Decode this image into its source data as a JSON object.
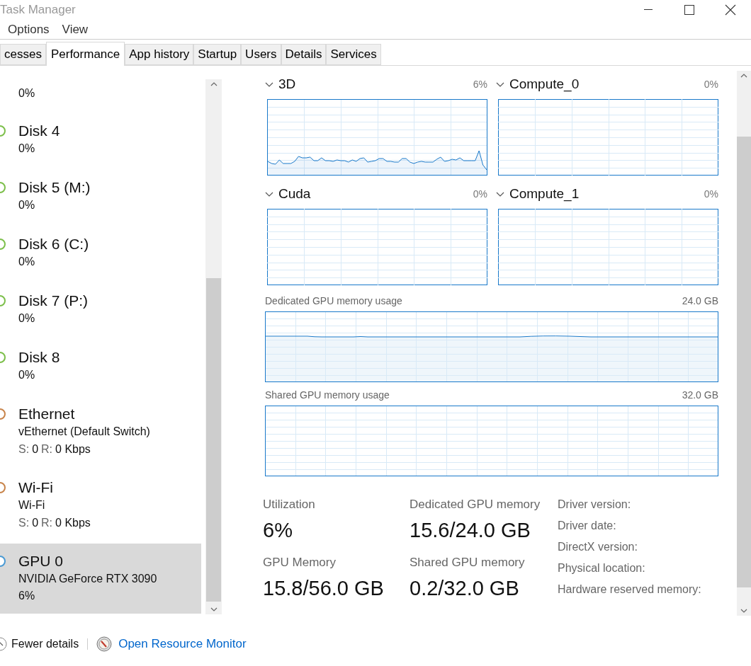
{
  "window": {
    "title": "Task Manager"
  },
  "menu": [
    "Options",
    "View"
  ],
  "tabs": [
    {
      "label": "cesses",
      "selected": false
    },
    {
      "label": "Performance",
      "selected": true
    },
    {
      "label": "App history",
      "selected": false
    },
    {
      "label": "Startup",
      "selected": false
    },
    {
      "label": "Users",
      "selected": false
    },
    {
      "label": "Details",
      "selected": false
    },
    {
      "label": "Services",
      "selected": false
    }
  ],
  "sidebar": {
    "items": [
      {
        "kind": "disk",
        "usage": "0%",
        "selected": false
      },
      {
        "kind": "disk",
        "title": "Disk 4",
        "usage": "0%",
        "selected": false,
        "color": "#7cbf4a"
      },
      {
        "kind": "disk",
        "title": "Disk 5 (M:)",
        "usage": "0%",
        "selected": false,
        "color": "#7cbf4a"
      },
      {
        "kind": "disk",
        "title": "Disk 6 (C:)",
        "usage": "0%",
        "selected": false,
        "color": "#7cbf4a"
      },
      {
        "kind": "disk",
        "title": "Disk 7 (P:)",
        "usage": "0%",
        "selected": false,
        "color": "#7cbf4a"
      },
      {
        "kind": "disk",
        "title": "Disk 8",
        "usage": "0%",
        "selected": false,
        "color": "#7cbf4a"
      },
      {
        "kind": "network",
        "title": "Ethernet",
        "adapter": "vEthernet (Default Switch)",
        "rates": [
          {
            "label": "S:",
            "value": "0"
          },
          {
            "label": "R:",
            "value": "0 Kbps"
          }
        ],
        "selected": false,
        "color": "#c8844a"
      },
      {
        "kind": "network",
        "title": "Wi-Fi",
        "adapter": "Wi-Fi",
        "rates": [
          {
            "label": "S:",
            "value": "0"
          },
          {
            "label": "R:",
            "value": "0 Kbps"
          }
        ],
        "selected": false,
        "color": "#c8844a"
      },
      {
        "kind": "gpu",
        "title": "GPU 0",
        "adapter": "NVIDIA GeForce RTX 3090",
        "usage": "6%",
        "selected": true,
        "color": "#4a9ad4"
      }
    ]
  },
  "engines": [
    {
      "name": "3D",
      "reading": "6%",
      "kind": "active"
    },
    {
      "name": "Compute_0",
      "reading": "0%",
      "kind": "idle"
    },
    {
      "name": "Cuda",
      "reading": "0%",
      "kind": "idle"
    },
    {
      "name": "Compute_1",
      "reading": "0%",
      "kind": "idle"
    }
  ],
  "memory_graphs": [
    {
      "title": "Dedicated GPU memory usage",
      "capacity": "24.0 GB",
      "kind": "filled"
    },
    {
      "title": "Shared GPU memory usage",
      "capacity": "32.0 GB",
      "kind": "empty"
    }
  ],
  "stats": [
    [
      {
        "label": "Utilization",
        "value": "6%"
      },
      {
        "label": "GPU Memory",
        "value": "15.8/56.0 GB"
      }
    ],
    [
      {
        "label": "Dedicated GPU memory",
        "value": "15.6/24.0 GB"
      },
      {
        "label": "Shared GPU memory",
        "value": "0.2/32.0 GB"
      }
    ]
  ],
  "details": [
    "Driver version:",
    "Driver date:",
    "DirectX version:",
    "Physical location:",
    "Hardware reserved memory:"
  ],
  "footer": {
    "fewer_details": "Fewer details",
    "link": "Open Resource Monitor"
  }
}
